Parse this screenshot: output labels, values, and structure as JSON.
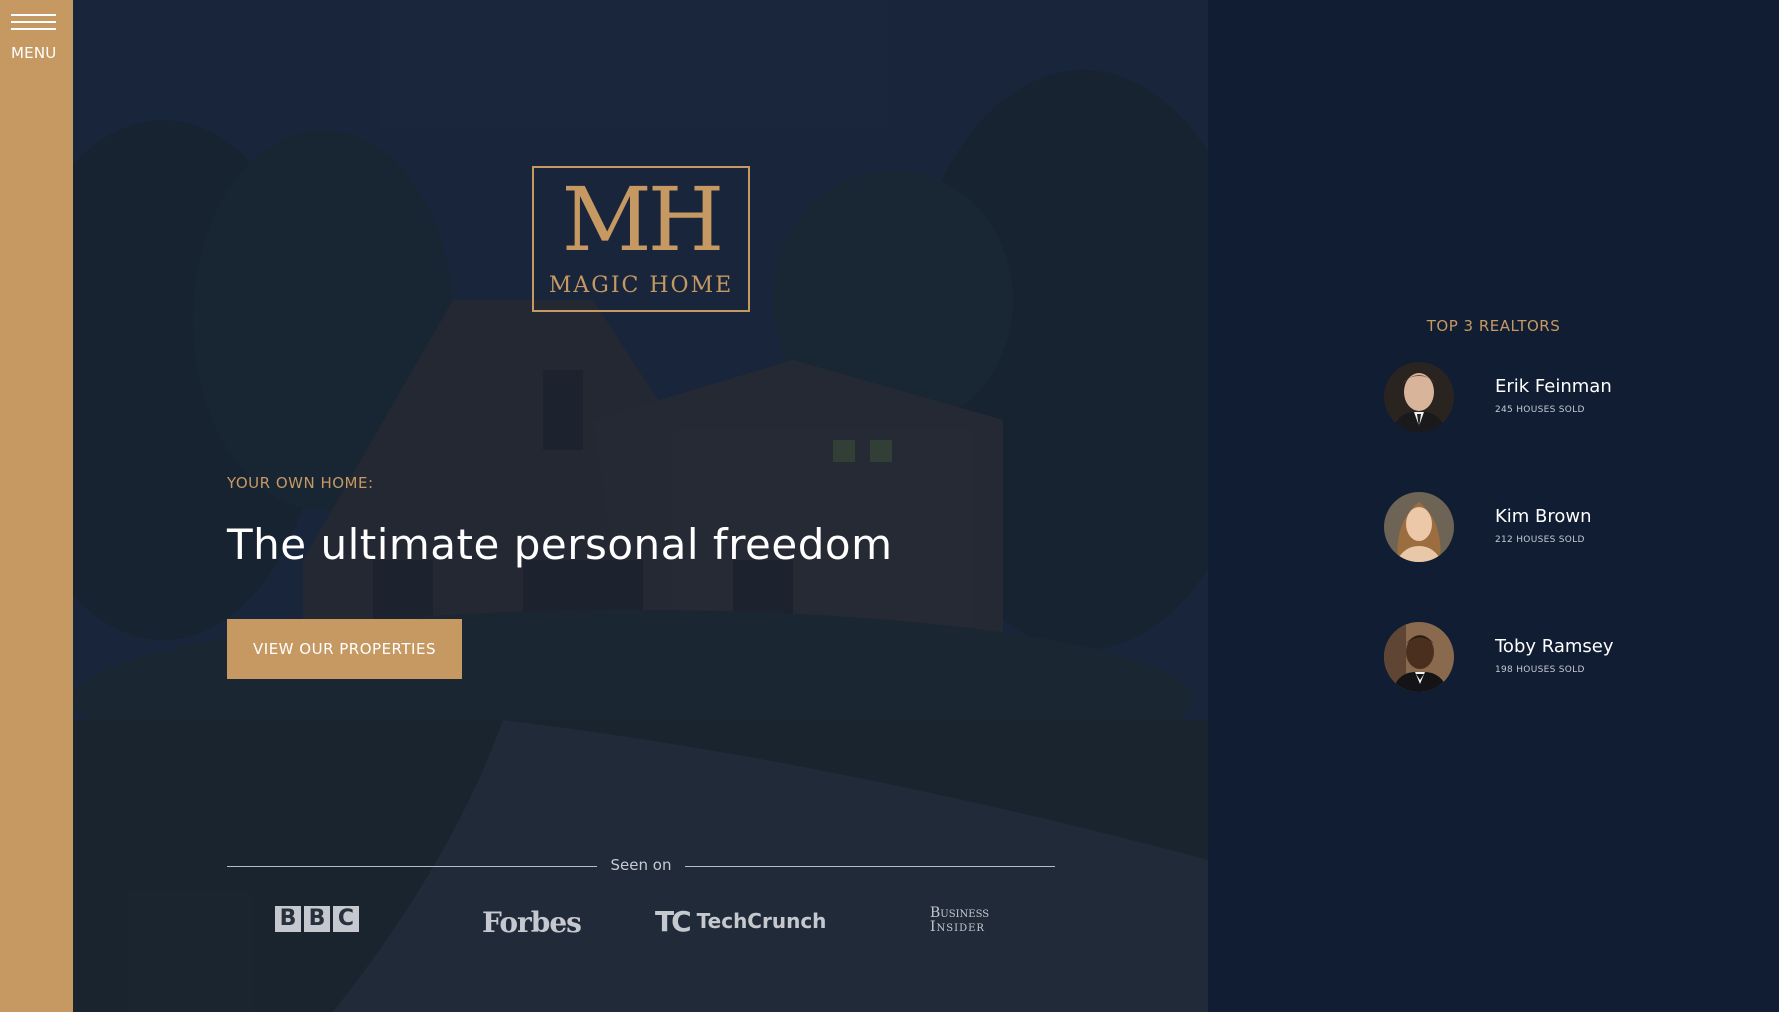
{
  "sidebar": {
    "menu_label": "MENU"
  },
  "logo": {
    "monogram": "MH",
    "name": "MAGIC HOME"
  },
  "hero": {
    "eyebrow": "YOUR OWN HOME:",
    "headline": "The ultimate personal freedom",
    "cta_label": "VIEW OUR PROPERTIES"
  },
  "seen_on": {
    "label": "Seen on",
    "logos": {
      "bbc": [
        "B",
        "B",
        "C"
      ],
      "forbes": "Forbes",
      "techcrunch_mark": "TC",
      "techcrunch": "TechCrunch",
      "business": "Business",
      "insider": "Insider"
    }
  },
  "realtors": {
    "title": "TOP 3 REALTORS",
    "items": [
      {
        "name": "Erik Feinman",
        "sold": "245 HOUSES SOLD"
      },
      {
        "name": "Kim Brown",
        "sold": "212 HOUSES SOLD"
      },
      {
        "name": "Toby Ramsey",
        "sold": "198 HOUSES SOLD"
      }
    ]
  },
  "colors": {
    "accent": "#c69963",
    "navy": "#101d33",
    "text": "#ffffff"
  }
}
